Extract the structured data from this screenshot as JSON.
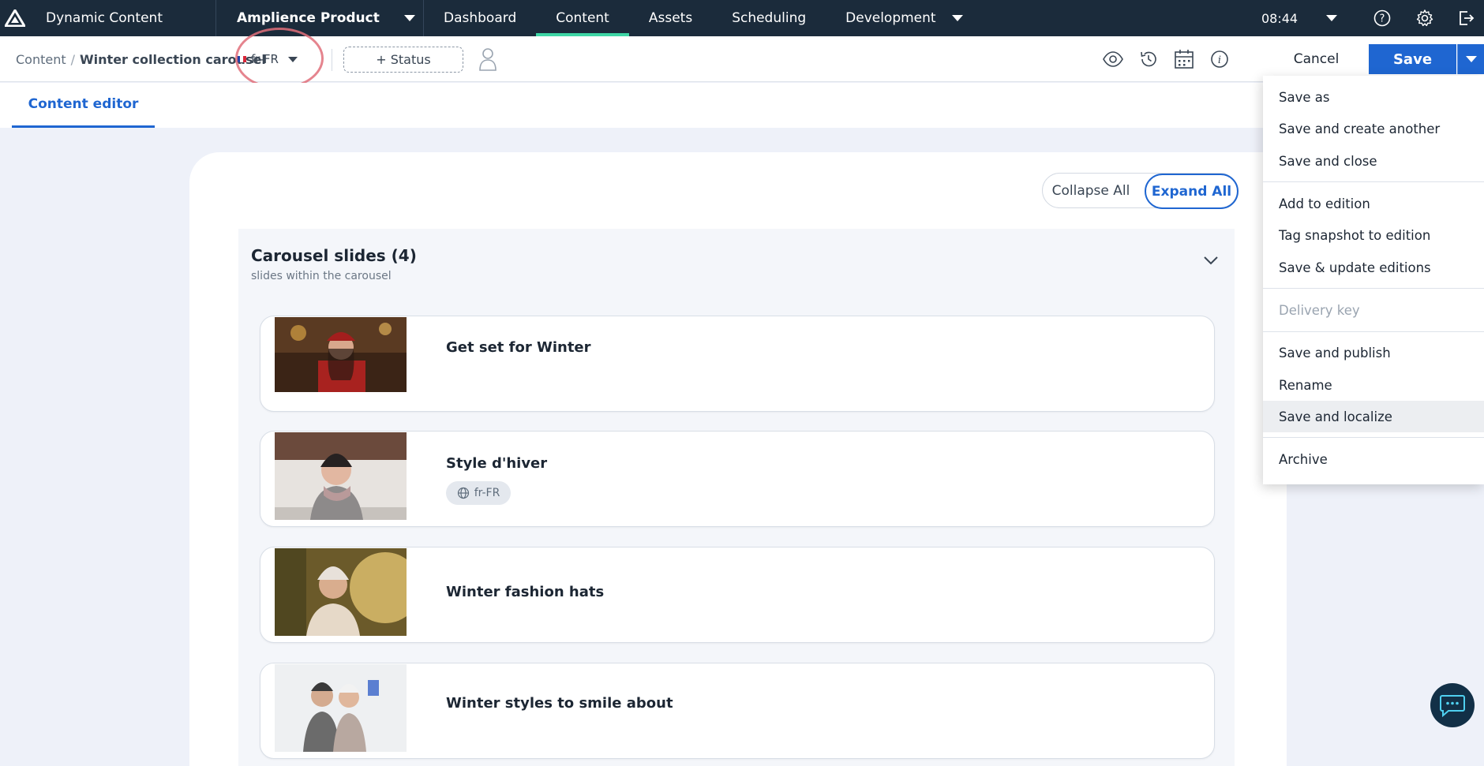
{
  "topnav": {
    "app_title": "Dynamic Content",
    "hub": "Amplience Product",
    "items": [
      {
        "label": "Dashboard"
      },
      {
        "label": "Content"
      },
      {
        "label": "Assets"
      },
      {
        "label": "Scheduling"
      },
      {
        "label": "Development"
      }
    ],
    "active_item": "Content",
    "time": "08:44"
  },
  "toolbar": {
    "breadcrumb_root": "Content",
    "breadcrumb_current": "Winter collection carousel",
    "locale": "fr-FR",
    "status_label": "+ Status",
    "cancel_label": "Cancel",
    "save_label": "Save"
  },
  "editor": {
    "tab_label": "Content editor",
    "collapse_label": "Collapse All",
    "expand_label": "Expand All",
    "slides_title": "Carousel slides (4)",
    "slides_subtitle": "slides within the carousel",
    "slides": [
      {
        "label": "Get set for Winter"
      },
      {
        "label": "Style d'hiver",
        "locale": "fr-FR"
      },
      {
        "label": "Winter fashion hats"
      },
      {
        "label": "Winter styles to smile about"
      }
    ]
  },
  "save_menu": {
    "items": [
      {
        "label": "Save as"
      },
      {
        "label": "Save and create another"
      },
      {
        "label": "Save and close"
      },
      {
        "label": "Add to edition"
      },
      {
        "label": "Tag snapshot to edition"
      },
      {
        "label": "Save & update editions"
      },
      {
        "label": "Delivery key",
        "disabled": true
      },
      {
        "label": "Save and publish"
      },
      {
        "label": "Rename"
      },
      {
        "label": "Save and localize",
        "highlighted": true
      },
      {
        "label": "Archive"
      }
    ]
  },
  "colors": {
    "nav_bg": "#1b2b3b",
    "active_underline": "#3ed6a5",
    "primary": "#1f66d1",
    "annotation_circle": "#e06f7a"
  }
}
